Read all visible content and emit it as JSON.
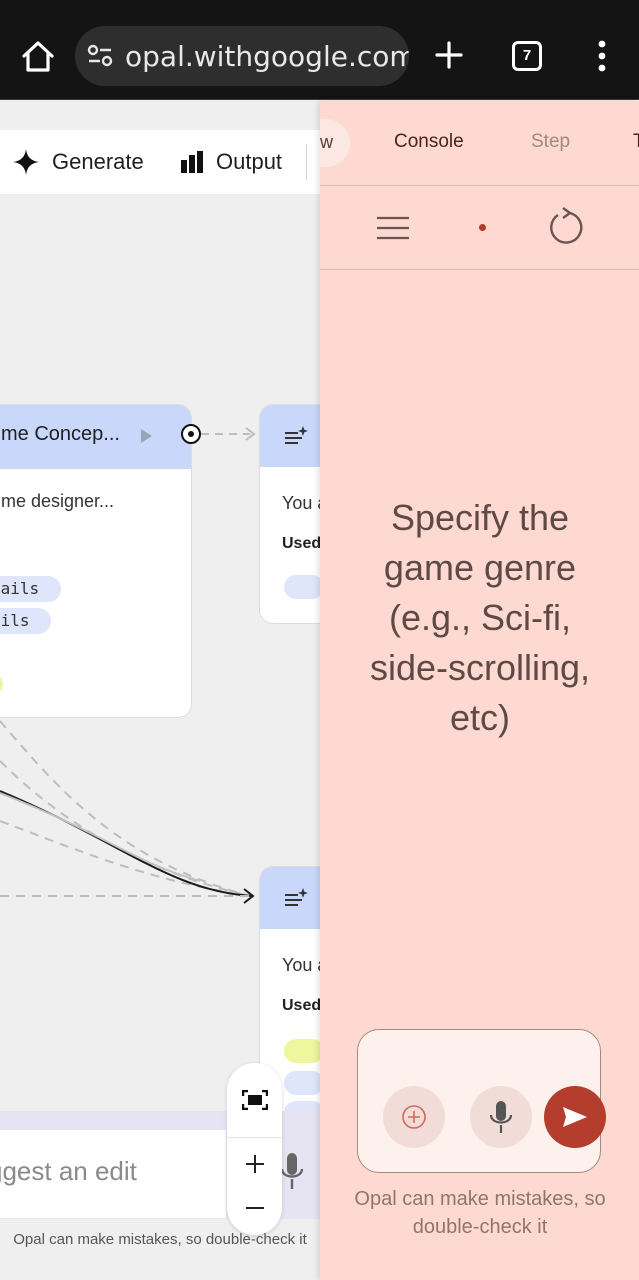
{
  "browser": {
    "url": "opal.withgoogle.com/",
    "tab_count": "7",
    "icons": [
      "home-icon",
      "site-settings-icon",
      "plus-icon",
      "tabs-icon",
      "more-vert-icon"
    ]
  },
  "toolbar": {
    "generate_label": "Generate",
    "output_label": "Output"
  },
  "nodes": {
    "concept": {
      "title": "me Concep...",
      "description": "me designer...",
      "chips": [
        "tails",
        "ails"
      ]
    },
    "top_right": {
      "text": "You a",
      "used": "Used"
    },
    "bottom_right": {
      "text": "You a",
      "used": "Used"
    }
  },
  "edit_bar": {
    "placeholder": "ggest an edit",
    "disclaimer": "Opal can make mistakes, so double-check it"
  },
  "console": {
    "tabs": {
      "previous": "w",
      "console": "Console",
      "step": "Step",
      "next": "T"
    },
    "prompt": "Specify the game genre (e.g., Sci-fi, side-scrolling, etc)",
    "disclaimer": "Opal can make mistakes, so double-check it",
    "colors": {
      "panel_bg": "#fdd9d1",
      "send_button": "#b53d2d",
      "accent_text": "#4a2320"
    }
  }
}
